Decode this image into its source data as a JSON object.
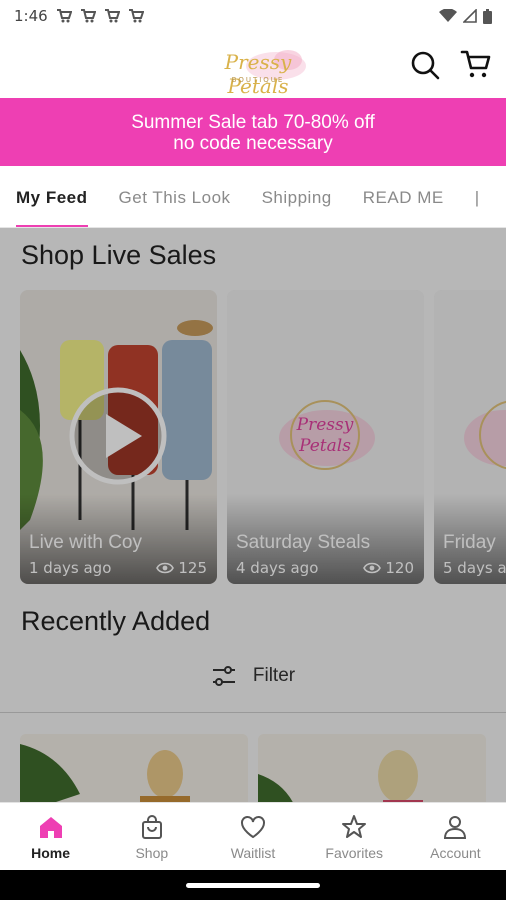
{
  "status": {
    "time": "1:46"
  },
  "header": {
    "logo_text": "Pressy Petals",
    "logo_sub": "BOUTIQUE"
  },
  "banner": {
    "line1": "Summer Sale tab 70-80% off",
    "line2": "no code necessary"
  },
  "tabs": [
    "My Feed",
    "Get This Look",
    "Shipping",
    "READ ME"
  ],
  "live_sales": {
    "title": "Shop Live Sales",
    "cards": [
      {
        "title": "Live with Coy",
        "age": "1 days ago",
        "views": "125"
      },
      {
        "title": "Saturday Steals",
        "age": "4 days ago",
        "views": "120"
      },
      {
        "title": "Friday",
        "age": "5 days a",
        "views": ""
      }
    ]
  },
  "recently_added": {
    "title": "Recently Added",
    "filter_label": "Filter"
  },
  "bottom_nav": [
    "Home",
    "Shop",
    "Waitlist",
    "Favorites",
    "Account"
  ],
  "colors": {
    "accent": "#ee3fb3",
    "gold": "#d9b24a"
  }
}
